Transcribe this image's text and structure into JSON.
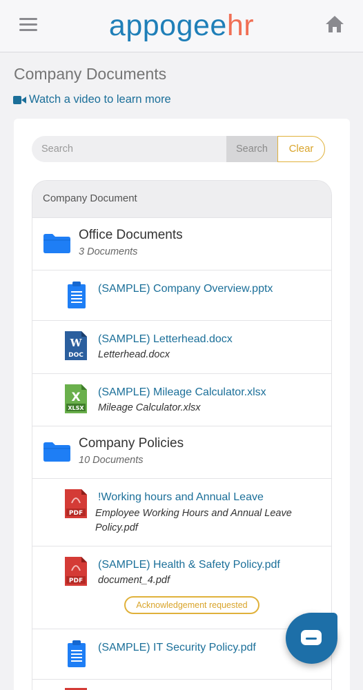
{
  "header": {
    "logo_part1": "appogee",
    "logo_part2": "hr",
    "brand_blue": "#1f7fb8",
    "brand_orange": "#f06f55"
  },
  "page": {
    "title": "Company Documents",
    "video_link": "Watch a video to learn more"
  },
  "search": {
    "placeholder": "Search",
    "search_label": "Search",
    "clear_label": "Clear"
  },
  "list": {
    "header": "Company Document",
    "folders": [
      {
        "name": "Office Documents",
        "count": "3 Documents",
        "documents": [
          {
            "name": "(SAMPLE) Company Overview.pptx",
            "subtitle": "",
            "icon": "clipboard-icon"
          },
          {
            "name": "(SAMPLE) Letterhead.docx",
            "subtitle": "Letterhead.docx",
            "icon": "doc-file-icon"
          },
          {
            "name": "(SAMPLE) Mileage Calculator.xlsx",
            "subtitle": "Mileage Calculator.xlsx",
            "icon": "xlsx-file-icon"
          }
        ]
      },
      {
        "name": "Company Policies",
        "count": "10 Documents",
        "documents": [
          {
            "name": "!Working hours and Annual Leave",
            "subtitle": "Employee Working Hours and Annual Leave Policy.pdf",
            "icon": "pdf-file-icon"
          },
          {
            "name": "(SAMPLE) Health & Safety Policy.pdf",
            "subtitle": "document_4.pdf",
            "icon": "pdf-file-icon",
            "badge": "Acknowledgement requested"
          },
          {
            "name": "(SAMPLE) IT Security Policy.pdf",
            "subtitle": "",
            "icon": "clipboard-icon"
          }
        ]
      }
    ]
  }
}
